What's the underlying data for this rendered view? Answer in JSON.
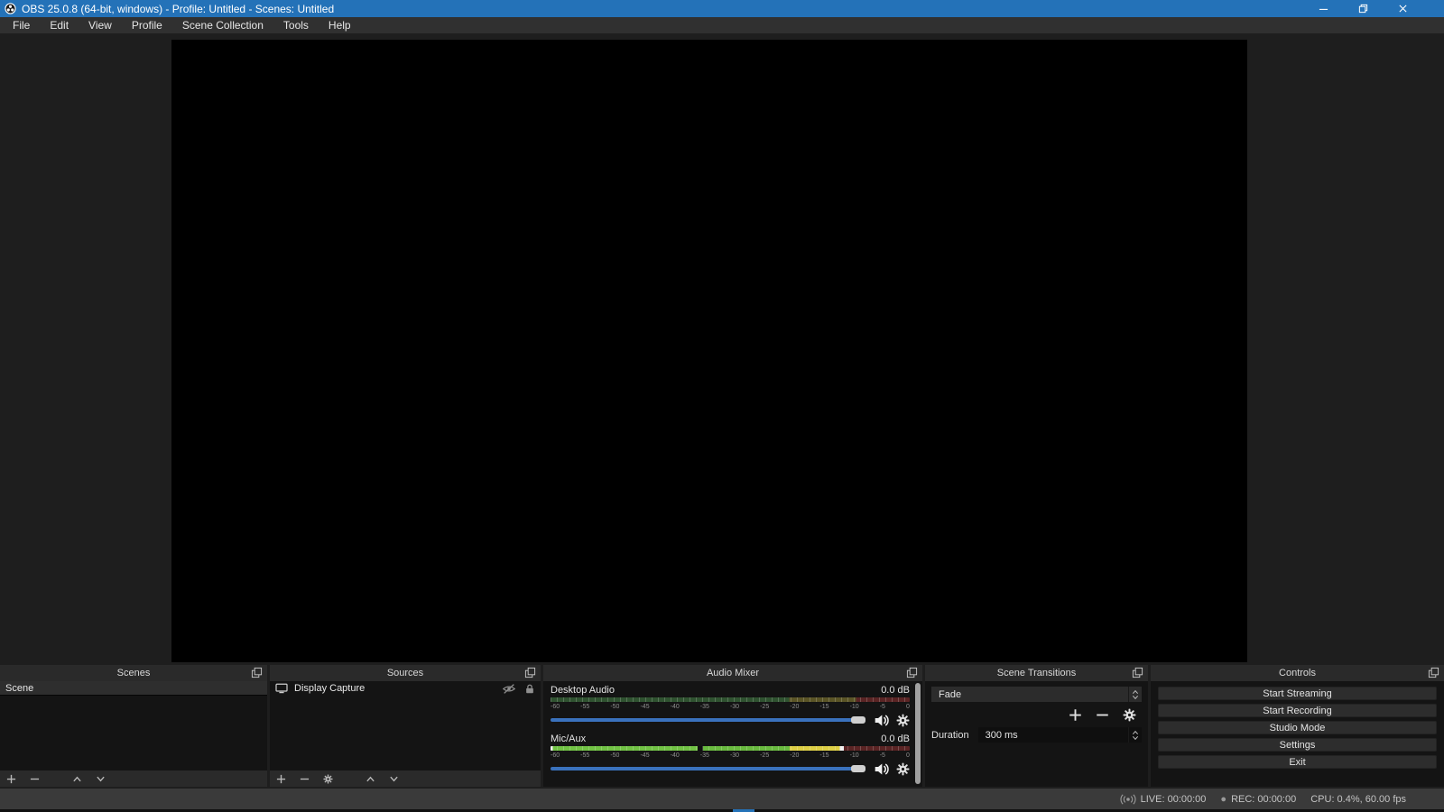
{
  "titlebar": {
    "title": "OBS 25.0.8 (64-bit, windows) - Profile: Untitled - Scenes: Untitled"
  },
  "menubar": {
    "items": [
      {
        "label": "File"
      },
      {
        "label": "Edit"
      },
      {
        "label": "View"
      },
      {
        "label": "Profile"
      },
      {
        "label": "Scene Collection"
      },
      {
        "label": "Tools"
      },
      {
        "label": "Help"
      }
    ]
  },
  "panels": {
    "scenes": {
      "title": "Scenes",
      "items": [
        {
          "label": "Scene"
        }
      ]
    },
    "sources": {
      "title": "Sources",
      "items": [
        {
          "label": "Display Capture"
        }
      ]
    },
    "audio_mixer": {
      "title": "Audio Mixer",
      "tick_labels": [
        "-60",
        "-55",
        "-50",
        "-45",
        "-40",
        "-35",
        "-30",
        "-25",
        "-20",
        "-15",
        "-10",
        "-5",
        "0"
      ],
      "mixers": [
        {
          "name": "Desktop Audio",
          "db": "0.0 dB"
        },
        {
          "name": "Mic/Aux",
          "db": "0.0 dB"
        }
      ]
    },
    "transitions": {
      "title": "Scene Transitions",
      "transition": "Fade",
      "duration_label": "Duration",
      "duration_value": "300 ms"
    },
    "controls": {
      "title": "Controls",
      "buttons": [
        "Start Streaming",
        "Start Recording",
        "Studio Mode",
        "Settings",
        "Exit"
      ]
    }
  },
  "statusbar": {
    "live": "LIVE: 00:00:00",
    "rec": "REC: 00:00:00",
    "cpu": "CPU: 0.4%, 60.00 fps"
  },
  "icons": {
    "record_dot": "●"
  },
  "colors": {
    "accent_blue": "#2472b8",
    "slider_blue": "#3a72bd",
    "meter_green": "#71c244",
    "meter_yellow": "#ddcf45",
    "meter_red": "#5a2424"
  }
}
